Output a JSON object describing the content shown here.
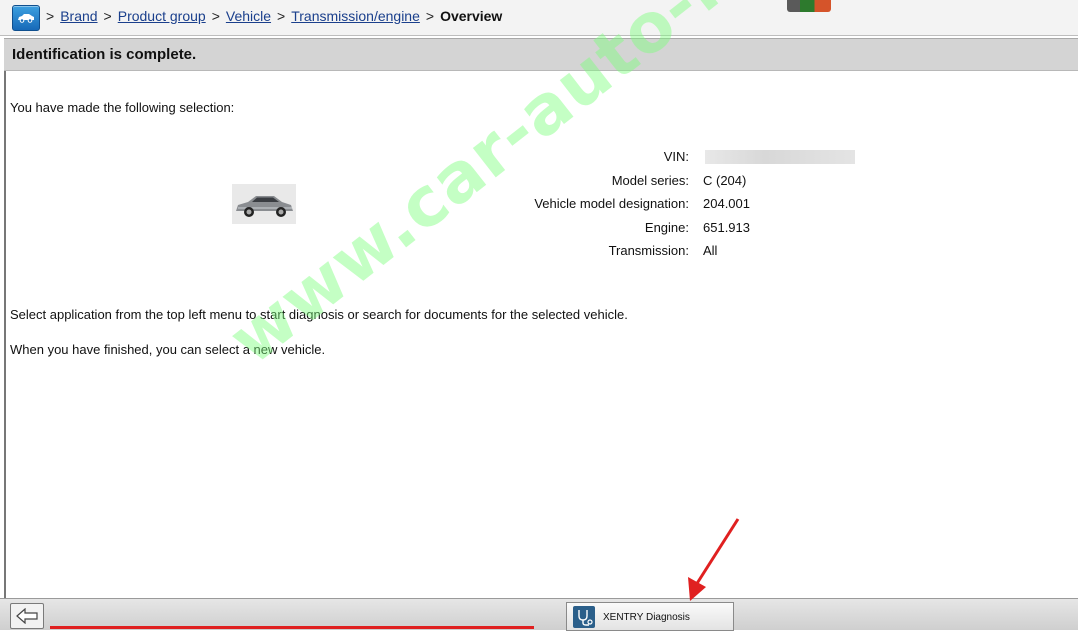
{
  "breadcrumb": {
    "items": [
      "Brand",
      "Product group",
      "Vehicle",
      "Transmission/engine"
    ],
    "current": "Overview",
    "separator": ">"
  },
  "header": {
    "title": "Identification is complete."
  },
  "main": {
    "intro": "You have made the following selection:",
    "vehicle_info": [
      {
        "label": "VIN:",
        "value": ""
      },
      {
        "label": "Model series:",
        "value": "C (204)"
      },
      {
        "label": "Vehicle model designation:",
        "value": "204.001"
      },
      {
        "label": "Engine:",
        "value": "651.913"
      },
      {
        "label": "Transmission:",
        "value": "All"
      }
    ],
    "instruction": "Select application from the top left menu to start diagnosis or search for documents for the selected vehicle.",
    "finish_note": "When you have finished, you can select a new vehicle."
  },
  "watermark": "www.car-auto-repair.com",
  "bottom_bar": {
    "app_button_label": "XENTRY Diagnosis"
  },
  "icons": {
    "home": "car-icon",
    "back": "back-arrow-icon",
    "app": "stethoscope-icon"
  },
  "colors": {
    "link": "#1a3f8c",
    "header_bg": "#d4d4d4",
    "home_button": "#1f7ccc",
    "annotation_red": "#e02020",
    "watermark_green": "#7dff7d"
  }
}
